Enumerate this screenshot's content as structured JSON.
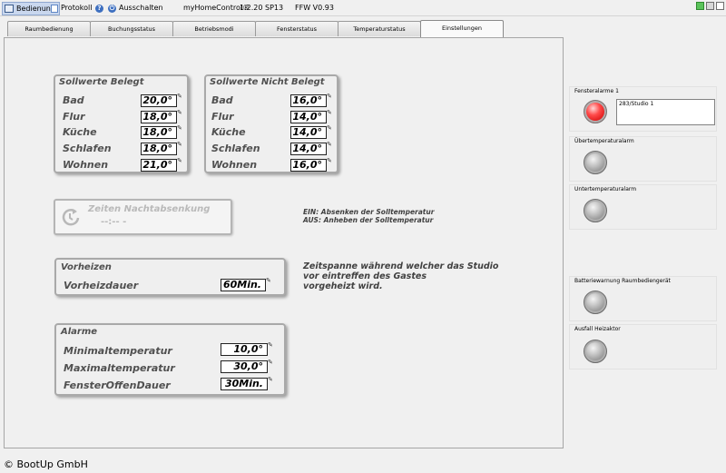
{
  "topbar": {
    "menu_bedienung": "Bedienung",
    "menu_protokoll": "Protokoll",
    "menu_ausschalten": "Ausschalten",
    "app_title": "myHomeControl®",
    "app_version": "1.2.20 SP13",
    "fw_version": "FFW V0.93"
  },
  "tabs": [
    {
      "label": "Raumbedienung",
      "active": false
    },
    {
      "label": "Buchungsstatus",
      "active": false
    },
    {
      "label": "Betriebsmodi",
      "active": false
    },
    {
      "label": "Fensterstatus",
      "active": false
    },
    {
      "label": "Temperaturstatus",
      "active": false
    },
    {
      "label": "Einstellungen",
      "active": true
    }
  ],
  "sollwerte_belegt": {
    "title": "Sollwerte Belegt",
    "rows": [
      {
        "label": "Bad",
        "value": "20,0°"
      },
      {
        "label": "Flur",
        "value": "18,0°"
      },
      {
        "label": "Küche",
        "value": "18,0°"
      },
      {
        "label": "Schlafen",
        "value": "18,0°"
      },
      {
        "label": "Wohnen",
        "value": "21,0°"
      }
    ]
  },
  "sollwerte_nicht_belegt": {
    "title": "Sollwerte Nicht Belegt",
    "rows": [
      {
        "label": "Bad",
        "value": "16,0°"
      },
      {
        "label": "Flur",
        "value": "14,0°"
      },
      {
        "label": "Küche",
        "value": "14,0°"
      },
      {
        "label": "Schlafen",
        "value": "14,0°"
      },
      {
        "label": "Wohnen",
        "value": "16,0°"
      }
    ]
  },
  "nachtabsenkung": {
    "title": "Zeiten Nachtabsenkung",
    "value": "--:-- -",
    "info_ein": "EIN: Absenken der Solltemperatur",
    "info_aus": "AUS: Anheben der Solltemperatur"
  },
  "vorheizen": {
    "title": "Vorheizen",
    "label": "Vorheizdauer",
    "value": "60Min.",
    "info": [
      "Zeitspanne während welcher das Studio",
      "vor eintreffen des Gastes",
      "vorgeheizt wird."
    ]
  },
  "alarme": {
    "title": "Alarme",
    "rows": [
      {
        "label": "Minimaltemperatur",
        "value": "10,0°"
      },
      {
        "label": "Maximaltemperatur",
        "value": "30,0°"
      },
      {
        "label": "FensterOffenDauer",
        "value": "30Min."
      }
    ]
  },
  "alarm_indicators": [
    {
      "label": "Fensteralarme 1",
      "state": "red",
      "text": "283/Studio 1"
    },
    {
      "label": "Übertemperaturalarm",
      "state": "grey"
    },
    {
      "label": "Untertemperaturalarm",
      "state": "grey"
    },
    {
      "label": "Batteriewarnung Raumbediengerät",
      "state": "grey"
    },
    {
      "label": "Ausfall Heizaktor",
      "state": "grey"
    }
  ],
  "colors": {
    "alarm_active": "#e01010",
    "alarm_inactive": "#9a9a9a",
    "tab_active": "#fafafa"
  },
  "footer": {
    "copyright": "© BootUp GmbH"
  }
}
